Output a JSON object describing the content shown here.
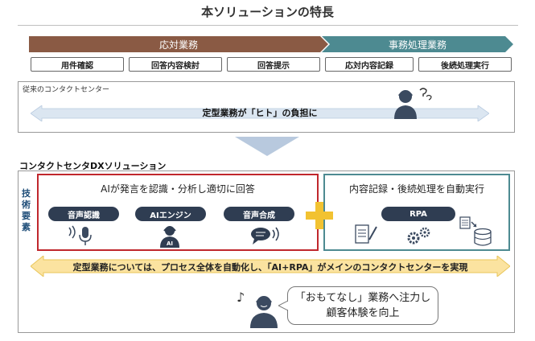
{
  "title": "本ソリューションの特長",
  "phases": {
    "left": "応対業務",
    "right": "事務処理業務"
  },
  "steps": [
    "用件確認",
    "回答内容検討",
    "回答提示",
    "応対内容記録",
    "後続処理実行"
  ],
  "traditional": {
    "label": "従来のコンタクトセンター",
    "arrow_text": "定型業務が「ヒト」の負担に"
  },
  "dx": {
    "title": "コンタクトセンタDXソリューション",
    "side_label": "技術要素",
    "ai_box": {
      "heading": "AIが発言を認識・分析し適切に回答",
      "pills": [
        "音声認識",
        "AIエンジン",
        "音声合成"
      ],
      "engine_icon_label": "AI"
    },
    "rpa_box": {
      "heading": "内容記録・後続処理を自動実行",
      "pill": "RPA"
    },
    "bottom_arrow_text": "定型業務については、プロセス全体を自動化し、「AI+RPA」がメインのコンタクトセンターを実現",
    "bubble": {
      "line1": "「おもてなし」業務へ注力し",
      "line2": "顧客体験を向上"
    }
  },
  "colors": {
    "left_phase": "#8a5a44",
    "right_phase": "#4d8a91",
    "ai_box_border": "#c0272d",
    "pill": "#2f3d52",
    "plus": "#f2c231"
  }
}
